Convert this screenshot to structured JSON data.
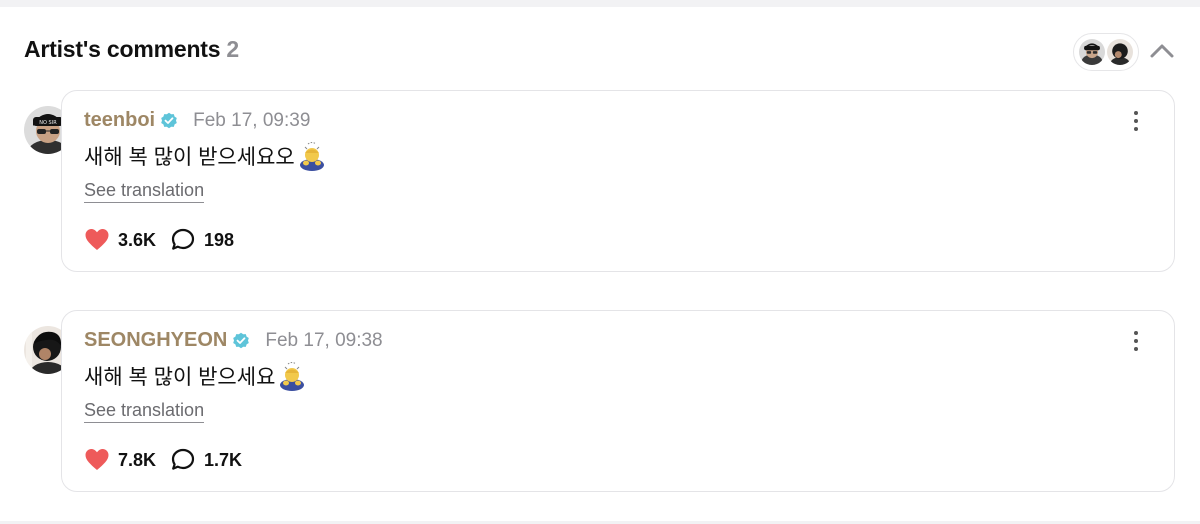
{
  "section": {
    "title": "Artist's comments",
    "count": "2"
  },
  "icons": {
    "collapse": "chevron-up-icon",
    "verified": "verified-badge-icon",
    "more": "more-vertical-icon",
    "like": "heart-icon",
    "reply": "speech-bubble-icon"
  },
  "colors": {
    "username": "#9e8765",
    "verified": "#5ec4d9",
    "heart": "#ee5a5a",
    "muted": "#8e8e93"
  },
  "comments": [
    {
      "username": "teenboi",
      "date": "Feb 17, 09:39",
      "text": "새해 복 많이 받으세요오",
      "emoji": "bowing-person-emoji",
      "see_translation": "See translation",
      "likes": "3.6K",
      "replies": "198"
    },
    {
      "username": "SEONGHYEON",
      "date": "Feb 17, 09:38",
      "text": "새해 복 많이 받으세요",
      "emoji": "bowing-person-emoji",
      "see_translation": "See translation",
      "likes": "7.8K",
      "replies": "1.7K"
    }
  ]
}
